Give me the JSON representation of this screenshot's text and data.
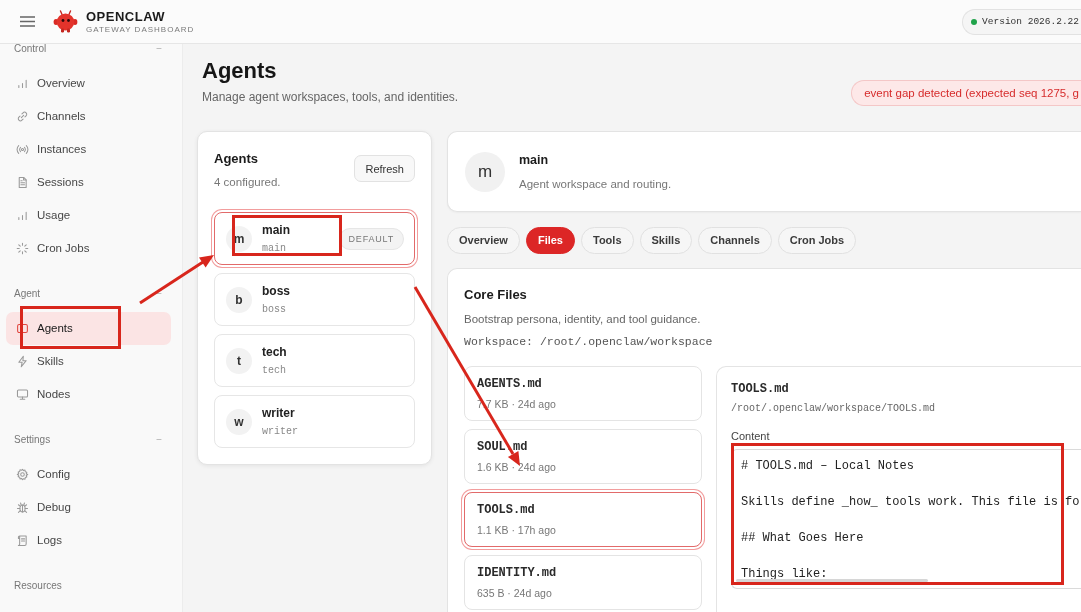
{
  "header": {
    "title": "OPENCLAW",
    "subtitle": "GATEWAY DASHBOARD",
    "version": "Version 2026.2.22",
    "connected": true
  },
  "sidebar": {
    "sections": [
      {
        "title": "Control",
        "toggle": "−",
        "items": [
          {
            "label": "Overview",
            "selected": false
          },
          {
            "label": "Channels",
            "selected": false
          },
          {
            "label": "Instances",
            "selected": false
          },
          {
            "label": "Sessions",
            "selected": false
          },
          {
            "label": "Usage",
            "selected": false
          },
          {
            "label": "Cron Jobs",
            "selected": false
          }
        ]
      },
      {
        "title": "Agent",
        "toggle": "−",
        "items": [
          {
            "label": "Agents",
            "selected": true
          },
          {
            "label": "Skills",
            "selected": false
          },
          {
            "label": "Nodes",
            "selected": false
          }
        ]
      },
      {
        "title": "Settings",
        "toggle": "−",
        "items": [
          {
            "label": "Config",
            "selected": false
          },
          {
            "label": "Debug",
            "selected": false
          },
          {
            "label": "Logs",
            "selected": false
          }
        ]
      },
      {
        "title": "Resources"
      }
    ]
  },
  "page": {
    "title": "Agents",
    "subtitle": "Manage agent workspaces, tools, and identities."
  },
  "toast": {
    "text": "event gap detected (expected seq 1275, g"
  },
  "agents_panel": {
    "title": "Agents",
    "count": "4 configured.",
    "refresh": "Refresh",
    "agents": [
      {
        "avatar": "m",
        "name": "main",
        "id": "main",
        "badge": "DEFAULT",
        "selected": true
      },
      {
        "avatar": "b",
        "name": "boss",
        "id": "boss",
        "selected": false
      },
      {
        "avatar": "t",
        "name": "tech",
        "id": "tech",
        "selected": false
      },
      {
        "avatar": "w",
        "name": "writer",
        "id": "writer",
        "selected": false
      }
    ]
  },
  "agent_detail": {
    "avatar": "m",
    "name": "main",
    "description": "Agent workspace and routing.",
    "tabs": [
      {
        "label": "Overview",
        "selected": false
      },
      {
        "label": "Files",
        "selected": true
      },
      {
        "label": "Tools",
        "selected": false
      },
      {
        "label": "Skills",
        "selected": false
      },
      {
        "label": "Channels",
        "selected": false
      },
      {
        "label": "Cron Jobs",
        "selected": false
      }
    ],
    "core_files": {
      "title": "Core Files",
      "description": "Bootstrap persona, identity, and tool guidance.",
      "workspace": "Workspace: /root/.openclaw/workspace",
      "files": [
        {
          "name": "AGENTS.md",
          "meta": "7.7 KB · 24d ago",
          "selected": false
        },
        {
          "name": "SOUL.md",
          "meta": "1.6 KB · 24d ago",
          "selected": false
        },
        {
          "name": "TOOLS.md",
          "meta": "1.1 KB · 17h ago",
          "selected": true
        },
        {
          "name": "IDENTITY.md",
          "meta": "635 B · 24d ago",
          "selected": false
        }
      ],
      "editor": {
        "title": "TOOLS.md",
        "path": "/root/.openclaw/workspace/TOOLS.md",
        "label": "Content",
        "content": "# TOOLS.md – Local Notes\n\nSkills define _how_ tools work. This file is fo\n\n## What Goes Here\n\nThings like:"
      }
    }
  }
}
